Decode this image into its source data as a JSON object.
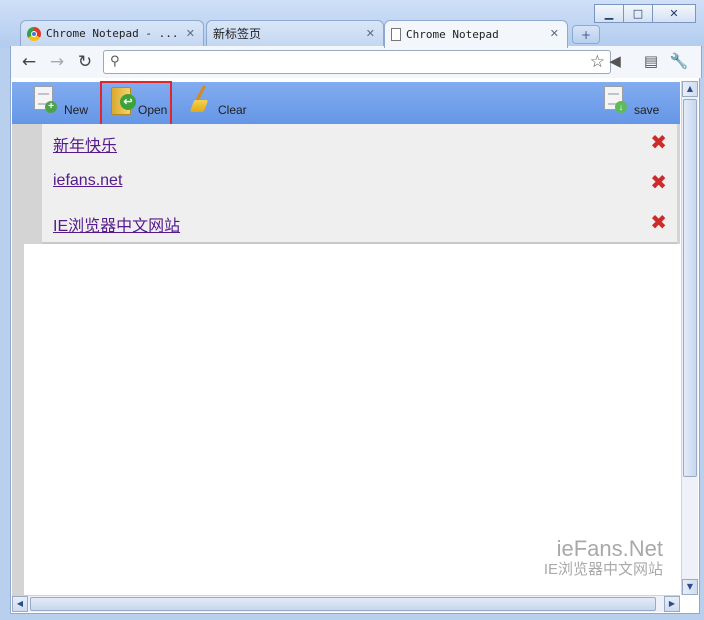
{
  "window": {
    "controls": {
      "minimize": "▁",
      "maximize": "□",
      "close": "✕"
    }
  },
  "tabs": [
    {
      "label": "Chrome Notepad - ...",
      "icon": "chrome-icon"
    },
    {
      "label": "新标签页",
      "icon": ""
    },
    {
      "label": "Chrome Notepad",
      "icon": "page-icon"
    }
  ],
  "tab_close_glyph": "✕",
  "new_tab_glyph": "+",
  "toolbar": {
    "back_glyph": "←",
    "forward_glyph": "→",
    "reload_glyph": "↻",
    "address_value": "",
    "search_glyph": "⚲",
    "star_glyph": "☆",
    "speaker_glyph": "◀",
    "page_glyph": "▤",
    "wrench_glyph": "🔧"
  },
  "app": {
    "buttons": {
      "new_label": "New",
      "open_label": "Open",
      "clear_label": "Clear",
      "save_label": "save"
    },
    "accent": "#e0262a",
    "notes": [
      {
        "title": "新年快乐"
      },
      {
        "title": "iefans.net"
      },
      {
        "title": "IE浏览器中文网站"
      }
    ],
    "delete_glyph": "✖"
  },
  "watermark": {
    "line1": "ieFans.Net",
    "line2": "IE浏览器中文网站"
  },
  "scroll": {
    "up": "▲",
    "down": "▼",
    "left": "◀",
    "right": "▶",
    "grip": "≡"
  }
}
